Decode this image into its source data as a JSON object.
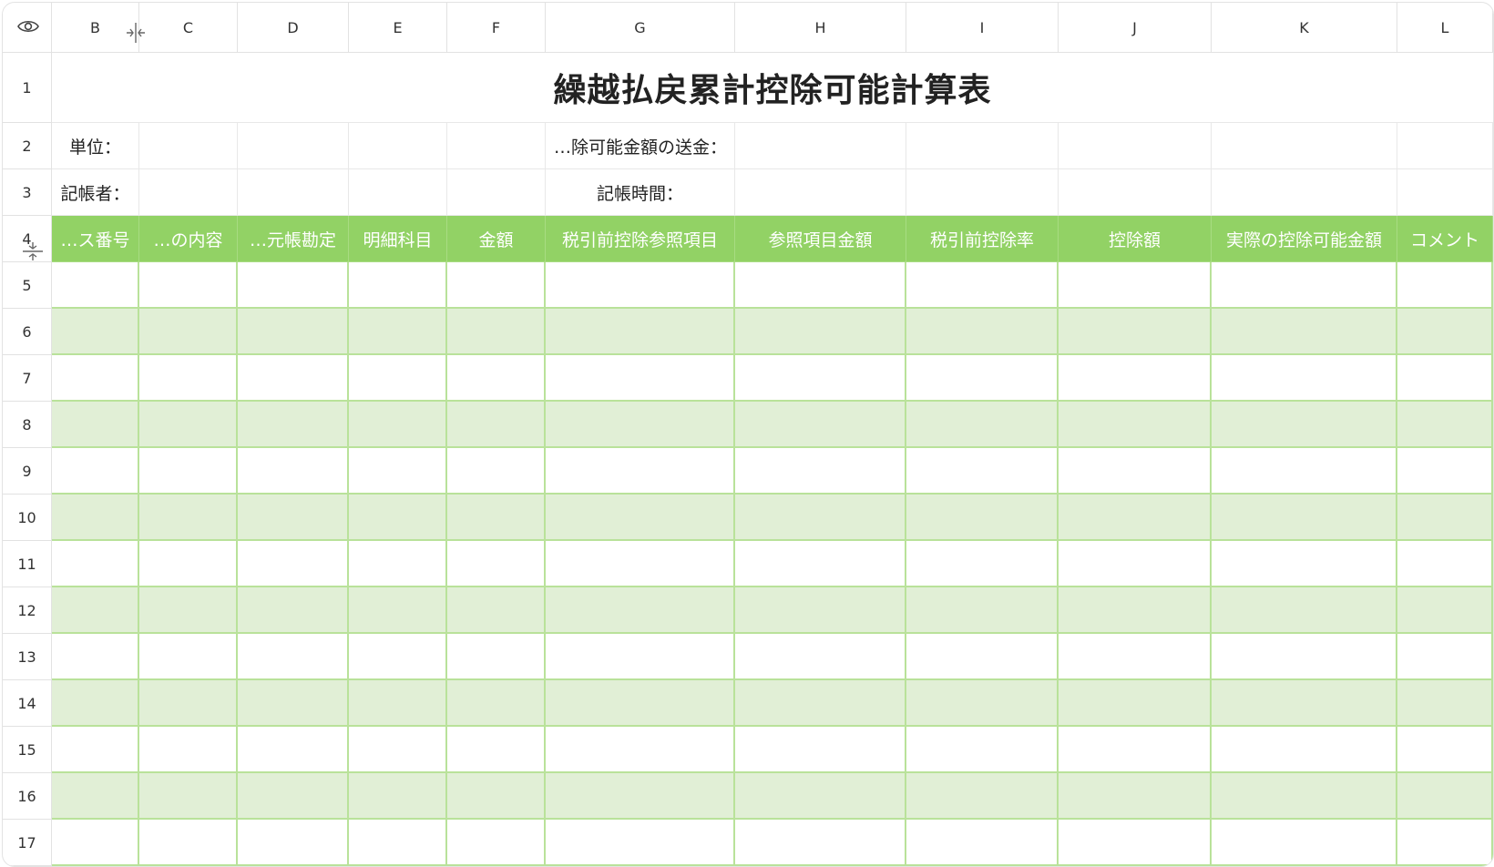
{
  "columns": [
    "B",
    "C",
    "D",
    "E",
    "F",
    "G",
    "H",
    "I",
    "J",
    "K",
    "L"
  ],
  "row_numbers": [
    "1",
    "2",
    "3",
    "4",
    "5",
    "6",
    "7",
    "8",
    "9",
    "10",
    "11",
    "12",
    "13",
    "14",
    "15",
    "16",
    "17"
  ],
  "title": "繰越払戻累計控除可能計算表",
  "info": {
    "unit_label": "単位：",
    "deductible_label": "…除可能金額の送金：",
    "recorder_label": "記帳者：",
    "record_time_label": "記帳時間："
  },
  "table_headers": [
    "…ス番号",
    "…の内容",
    "…元帳勘定",
    "明細科目",
    "金額",
    "税引前控除参照項目",
    "参照項目金額",
    "税引前控除率",
    "控除額",
    "実際の控除可能金額",
    "コメント"
  ],
  "colors": {
    "header_green": "#92d265",
    "band_green": "#e1efd6",
    "grid_line_green": "#b9e29a"
  },
  "icons": {
    "corner": "eye-icon",
    "col_resize": "column-resize-icon",
    "row_resize": "row-resize-icon"
  }
}
